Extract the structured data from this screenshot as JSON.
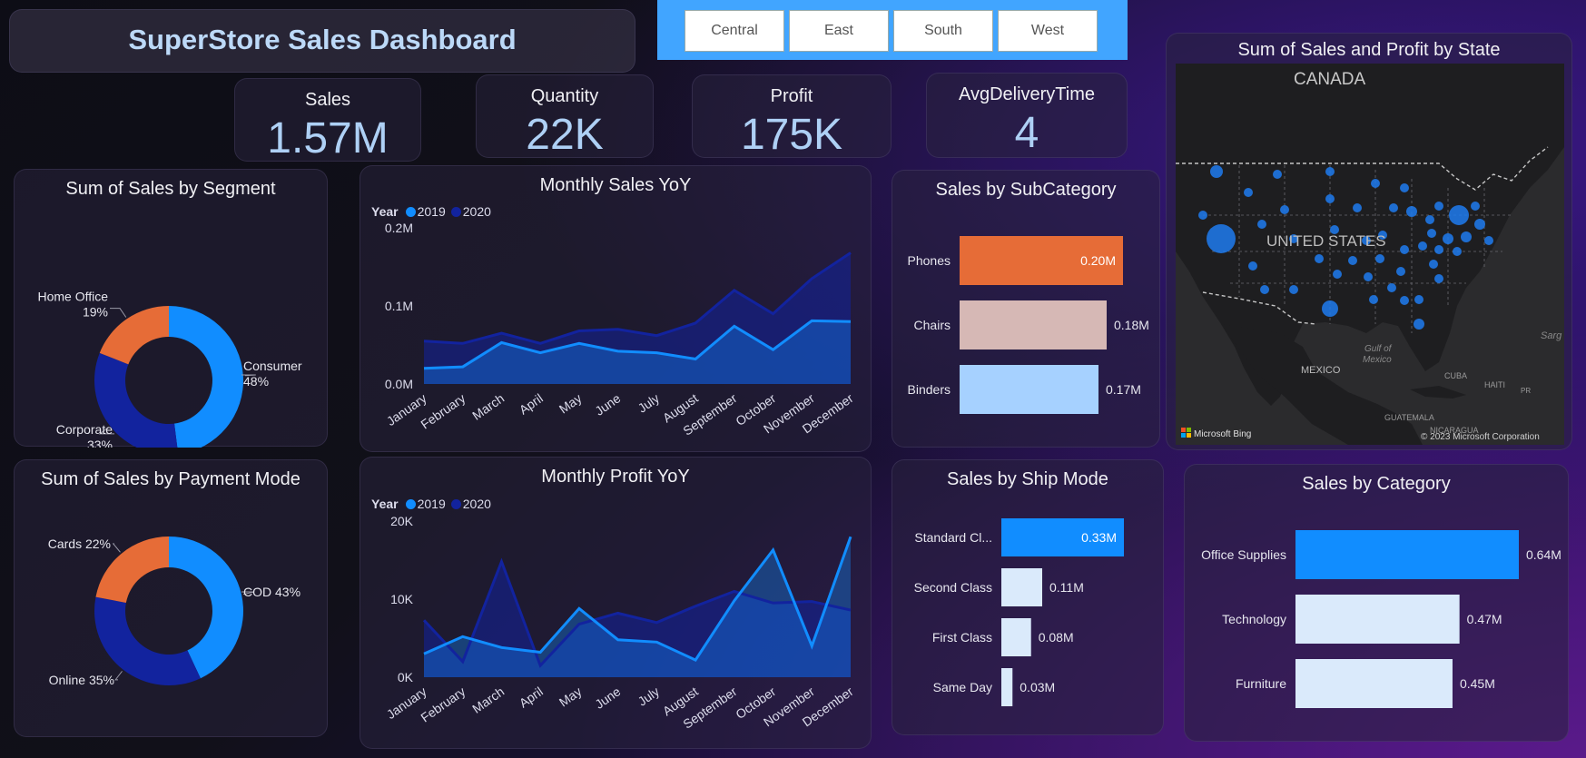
{
  "title": "SuperStore Sales Dashboard",
  "regions": [
    "Central",
    "East",
    "South",
    "West"
  ],
  "kpis": [
    {
      "label": "Sales",
      "value": "1.57M"
    },
    {
      "label": "Quantity",
      "value": "22K"
    },
    {
      "label": "Profit",
      "value": "175K"
    },
    {
      "label": "AvgDeliveryTime",
      "value": "4"
    }
  ],
  "colors": {
    "accent_blue": "#118dff",
    "navy": "#12239e",
    "orange": "#e66c37",
    "light_blue": "#a6d1ff",
    "pink": "#d6b8b5"
  },
  "segment_chart": {
    "title": "Sum of Sales by Segment",
    "chart_data": {
      "type": "pie",
      "slices": [
        {
          "name": "Consumer",
          "pct_label": "48%",
          "value": 48,
          "color": "#118dff"
        },
        {
          "name": "Corporate",
          "pct_label": "33%",
          "value": 33,
          "color": "#12239e"
        },
        {
          "name": "Home Office",
          "pct_label": "19%",
          "value": 19,
          "color": "#e66c37"
        }
      ]
    }
  },
  "payment_chart": {
    "title": "Sum of Sales by Payment Mode",
    "chart_data": {
      "type": "pie",
      "slices": [
        {
          "name": "COD",
          "pct_label": "43%",
          "value": 43,
          "color": "#118dff"
        },
        {
          "name": "Online",
          "pct_label": "35%",
          "value": 35,
          "color": "#12239e"
        },
        {
          "name": "Cards",
          "pct_label": "22%",
          "value": 22,
          "color": "#e66c37"
        }
      ]
    }
  },
  "sales_yoy": {
    "title": "Monthly Sales YoY",
    "legend_label": "Year",
    "chart_data": {
      "type": "area",
      "categories": [
        "January",
        "February",
        "March",
        "April",
        "May",
        "June",
        "July",
        "August",
        "September",
        "October",
        "November",
        "December"
      ],
      "series": [
        {
          "name": "2019",
          "values": [
            0.02,
            0.022,
            0.053,
            0.04,
            0.052,
            0.042,
            0.04,
            0.032,
            0.074,
            0.044,
            0.081,
            0.08
          ],
          "color": "#118dff"
        },
        {
          "name": "2020",
          "values": [
            0.055,
            0.052,
            0.065,
            0.052,
            0.068,
            0.07,
            0.062,
            0.078,
            0.12,
            0.09,
            0.135,
            0.168
          ],
          "color": "#12239e"
        }
      ],
      "yticks": [
        "0.0M",
        "0.1M",
        "0.2M"
      ],
      "ylim": [
        0,
        0.2
      ]
    }
  },
  "profit_yoy": {
    "title": "Monthly Profit YoY",
    "legend_label": "Year",
    "chart_data": {
      "type": "area",
      "categories": [
        "January",
        "February",
        "March",
        "April",
        "May",
        "June",
        "July",
        "August",
        "September",
        "October",
        "November",
        "December"
      ],
      "series": [
        {
          "name": "2019",
          "values": [
            3000,
            5200,
            3800,
            3200,
            8800,
            4800,
            4500,
            2200,
            9800,
            16300,
            4000,
            18000
          ],
          "color": "#118dff"
        },
        {
          "name": "2020",
          "values": [
            7300,
            2000,
            14800,
            1500,
            6800,
            8200,
            7000,
            9100,
            11000,
            9500,
            9700,
            8600
          ],
          "color": "#12239e"
        }
      ],
      "yticks": [
        "0K",
        "10K",
        "20K"
      ],
      "ylim": [
        0,
        20000
      ]
    }
  },
  "subcategory_chart": {
    "title": "Sales by SubCategory",
    "chart_data": {
      "type": "bar",
      "categories": [
        "Phones",
        "Chairs",
        "Binders"
      ],
      "values": [
        0.2,
        0.18,
        0.17
      ],
      "labels": [
        "0.20M",
        "0.18M",
        "0.17M"
      ],
      "colors": [
        "#e66c37",
        "#d6b8b5",
        "#a6d1ff"
      ],
      "xlim": [
        0,
        0.2
      ]
    }
  },
  "shipmode_chart": {
    "title": "Sales by Ship Mode",
    "chart_data": {
      "type": "bar",
      "categories": [
        "Standard Cl...",
        "Second Class",
        "First Class",
        "Same Day"
      ],
      "values": [
        0.33,
        0.11,
        0.08,
        0.03
      ],
      "labels": [
        "0.33M",
        "0.11M",
        "0.08M",
        "0.03M"
      ],
      "colors": [
        "#118dff",
        "#daeafb",
        "#daeafb",
        "#daeafb"
      ],
      "xlim": [
        0,
        0.33
      ]
    }
  },
  "category_chart": {
    "title": "Sales by Category",
    "chart_data": {
      "type": "bar",
      "categories": [
        "Office Supplies",
        "Technology",
        "Furniture"
      ],
      "values": [
        0.64,
        0.47,
        0.45
      ],
      "labels": [
        "0.64M",
        "0.47M",
        "0.45M"
      ],
      "colors": [
        "#118dff",
        "#daeafb",
        "#daeafb"
      ],
      "xlim": [
        0,
        0.64
      ]
    }
  },
  "map": {
    "title": "Sum of Sales and Profit by State",
    "labels": {
      "canada": "CANADA",
      "us": "UNITED STATES",
      "mexico": "MEXICO",
      "gulf": "Gulf of Mexico",
      "cuba": "CUBA",
      "haiti": "HAITI",
      "guatemala": "GUATEMALA",
      "nicaragua": "NICARAGUA",
      "sargasso": "Sarg"
    },
    "bing_label": "Microsoft Bing",
    "copyright": "© 2023 Microsoft Corporation"
  }
}
